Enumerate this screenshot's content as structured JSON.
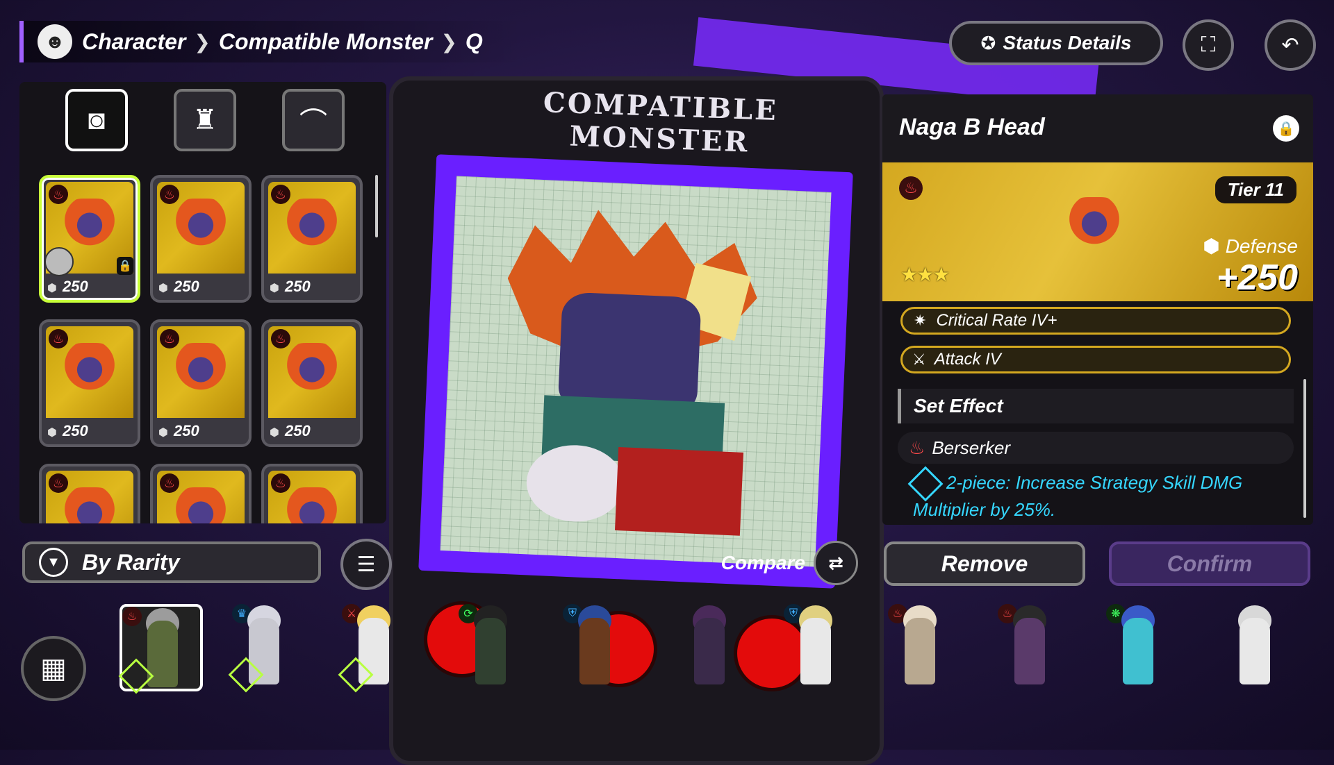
{
  "breadcrumb": {
    "items": [
      "Character",
      "Compatible Monster",
      "Q"
    ]
  },
  "header": {
    "status_details_label": "Status Details"
  },
  "category_tabs": [
    "head-icon",
    "body-icon",
    "wing-icon"
  ],
  "cards": [
    {
      "value": "250",
      "selected": true,
      "locked": true
    },
    {
      "value": "250"
    },
    {
      "value": "250"
    },
    {
      "value": "250"
    },
    {
      "value": "250"
    },
    {
      "value": "250"
    },
    {
      "value": ""
    },
    {
      "value": ""
    },
    {
      "value": ""
    }
  ],
  "center": {
    "title": "COMPATIBLE MONSTER",
    "compare_label": "Compare"
  },
  "detail": {
    "name": "Naga B Head",
    "tier": "Tier 11",
    "stars": "★★★",
    "stat_label": "Defense",
    "stat_value": "+250",
    "substats": [
      "Critical Rate IV+",
      "Attack IV"
    ],
    "set_effect_title": "Set Effect",
    "set_name": "Berserker",
    "set_desc": "2-piece: Increase Strategy Skill DMG Multiplier by 25%."
  },
  "bottom": {
    "filter_label": "By Rarity",
    "remove_label": "Remove",
    "confirm_label": "Confirm"
  },
  "colors": {
    "accent": "#7a2cff",
    "gold": "#d4a820",
    "confirm_disabled": "#3a2660",
    "highlight": "#c8ff3a",
    "set_text": "#35d7ff"
  }
}
